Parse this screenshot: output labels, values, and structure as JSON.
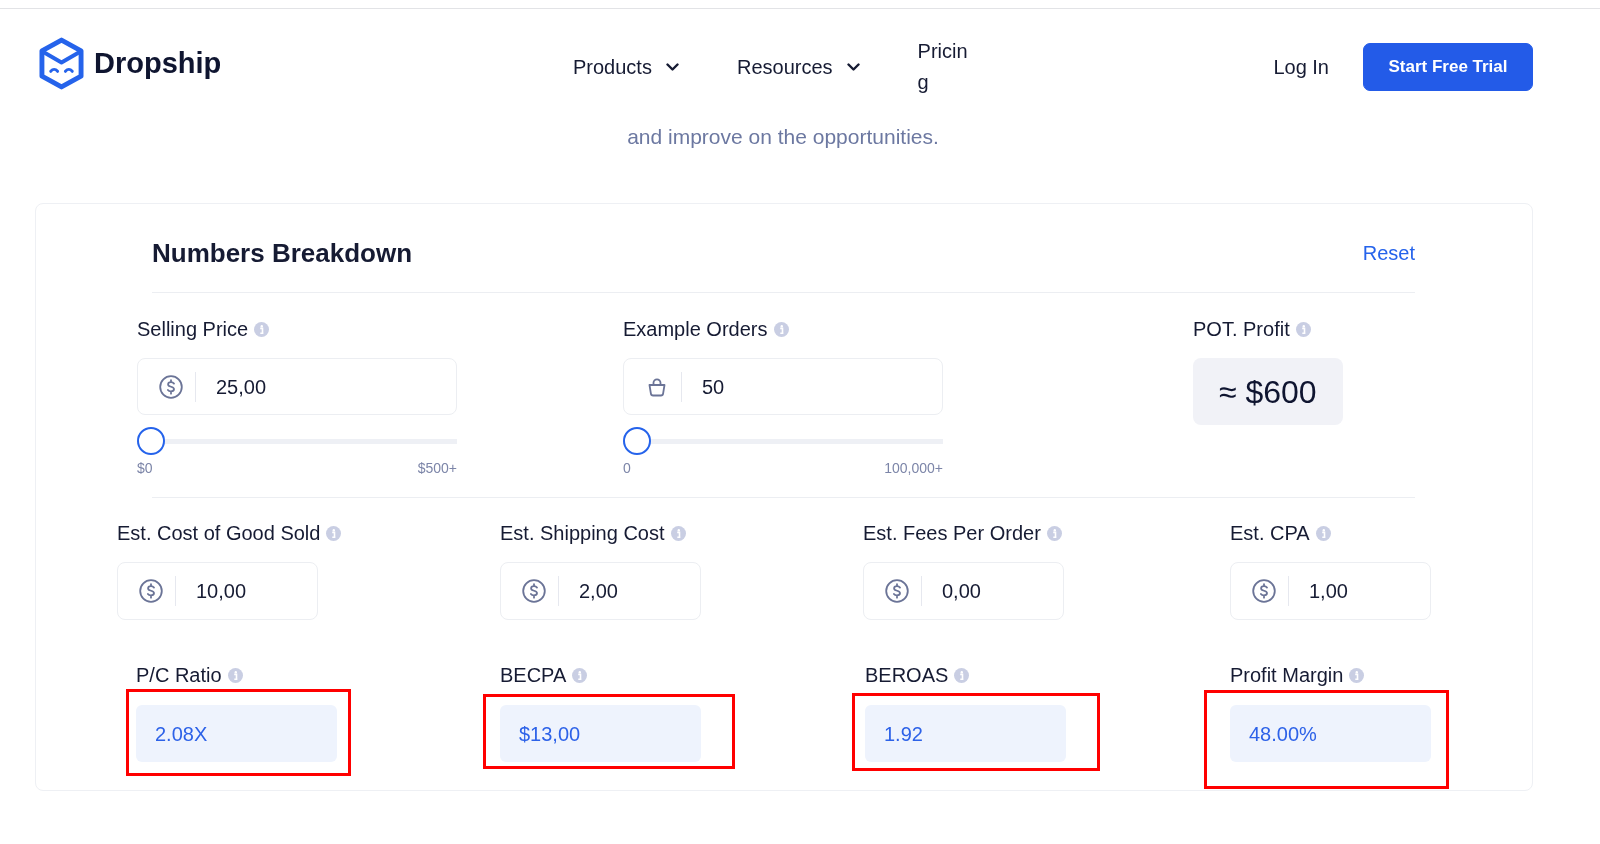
{
  "header": {
    "logo_text": "Dropship",
    "nav": [
      {
        "label": "Products",
        "kind": "dropdown"
      },
      {
        "label": "Resources",
        "kind": "dropdown"
      },
      {
        "label": "Pricing",
        "kind": "link"
      }
    ],
    "login": "Log In",
    "cta": "Start Free Trial"
  },
  "intro_text": "and improve on the opportunities.",
  "calculator": {
    "title": "Numbers Breakdown",
    "reset": "Reset",
    "primary_inputs": [
      {
        "label": "Selling Price",
        "kind": "currency",
        "value": "25,00",
        "level": 0,
        "min_label": "$0",
        "max_label": "$500+"
      },
      {
        "label": "Example Orders",
        "kind": "count",
        "value": "50",
        "level": 0,
        "min_label": "0",
        "max_label": "100,000+"
      }
    ],
    "potential_profit": {
      "label": "POT. Profit",
      "value": "≈ $600"
    },
    "cost_inputs": [
      {
        "label": "Est. Cost of Good Sold",
        "value": "10,00"
      },
      {
        "label": "Est. Shipping Cost",
        "value": "2,00"
      },
      {
        "label": "Est. Fees Per Order",
        "value": "0,00"
      },
      {
        "label": "Est. CPA",
        "value": "1,00"
      }
    ],
    "results": [
      {
        "label": "P/C Ratio",
        "value": "2.08X",
        "highlighted": true
      },
      {
        "label": "BECPA",
        "value": "$13,00",
        "highlighted": true
      },
      {
        "label": "BEROAS",
        "value": "1.92",
        "highlighted": true
      },
      {
        "label": "Profit Margin",
        "value": "48.00%",
        "highlighted": true
      }
    ]
  }
}
